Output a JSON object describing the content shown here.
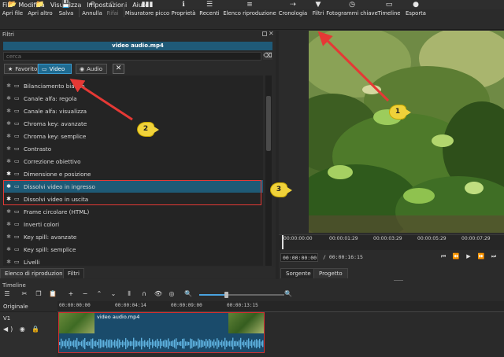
{
  "menu": [
    "File",
    "Modifica",
    "Visualizza",
    "Impostazioni",
    "Aiuto"
  ],
  "toolbar": [
    {
      "icon": "folder-open-icon",
      "glyph": "📂",
      "label": "Apri file"
    },
    {
      "icon": "folder-other-icon",
      "glyph": "📁",
      "label": "Apri altro"
    },
    {
      "icon": "save-icon",
      "glyph": "💾",
      "label": "Salva"
    },
    {
      "icon": "undo-icon",
      "glyph": "↶",
      "label": "Annulla"
    },
    {
      "icon": "redo-icon",
      "glyph": "↷",
      "label": "Rifai"
    },
    {
      "icon": "peak-meter-icon",
      "glyph": "▮▮▮",
      "label": "Misuratore picco"
    },
    {
      "icon": "info-icon",
      "glyph": "ℹ",
      "label": "Proprietà"
    },
    {
      "icon": "recent-icon",
      "glyph": "☰",
      "label": "Recenti"
    },
    {
      "icon": "playlist-icon",
      "glyph": "≡",
      "label": "Elenco riproduzione"
    },
    {
      "icon": "history-icon",
      "glyph": "⇢",
      "label": "Cronologia"
    },
    {
      "icon": "filter-icon",
      "glyph": "▼",
      "label": "Filtri"
    },
    {
      "icon": "keyframes-icon",
      "glyph": "◷",
      "label": "Fotogrammi chiave"
    },
    {
      "icon": "timeline-icon",
      "glyph": "▭",
      "label": "Timeline"
    },
    {
      "icon": "export-icon",
      "glyph": "●",
      "label": "Esporta"
    }
  ],
  "filters_panel": {
    "title": "Filtri",
    "clip_name": "video audio.mp4",
    "search_placeholder": "cerca",
    "tabs": {
      "favorite": "Favorito",
      "video": "Video",
      "audio": "Audio"
    },
    "items": [
      {
        "label": "Bilanciamento bianco",
        "favorite": false
      },
      {
        "label": "Canale alfa: regola",
        "favorite": false
      },
      {
        "label": "Canale alfa: visualizza",
        "favorite": false
      },
      {
        "label": "Chroma key: avanzate",
        "favorite": false
      },
      {
        "label": "Chroma key: semplice",
        "favorite": false
      },
      {
        "label": "Contrasto",
        "favorite": false
      },
      {
        "label": "Correzione obiettivo",
        "favorite": false
      },
      {
        "label": "Dimensione e posizione",
        "favorite": true
      },
      {
        "label": "Dissolvi video in ingresso",
        "favorite": true,
        "selected": true
      },
      {
        "label": "Dissolvi video in uscita",
        "favorite": true
      },
      {
        "label": "Frame circolare (HTML)",
        "favorite": false
      },
      {
        "label": "Inverti colori",
        "favorite": false
      },
      {
        "label": "Key spill: avanzate",
        "favorite": false
      },
      {
        "label": "Key spill: semplice",
        "favorite": false
      },
      {
        "label": "Livelli",
        "favorite": false
      }
    ],
    "bottom_tabs": [
      "Elenco di riproduzione",
      "Filtri"
    ]
  },
  "player": {
    "ruler_ticks": [
      "00:00:00:00",
      "00:00:01:29",
      "00:00:03:29",
      "00:00:05:29",
      "00:00:07:29"
    ],
    "current_time": "00:00:00:00",
    "total_time": "/ 00:00:16:15",
    "tabs": [
      "Sorgente",
      "Progetto"
    ]
  },
  "timeline": {
    "title": "Timeline",
    "track_original": "Originale",
    "track_v1": "V1",
    "ticks": [
      "00:00:00:00",
      "00:00:04:14",
      "00:00:09:00",
      "00:00:13:15"
    ],
    "clip_title": "video audio.mp4"
  },
  "annotations": [
    "1",
    "2",
    "3"
  ],
  "colors": {
    "accent": "#1e6b91",
    "selection": "#1e5a76",
    "highlight": "#e53935",
    "badge": "#f0d23a"
  }
}
